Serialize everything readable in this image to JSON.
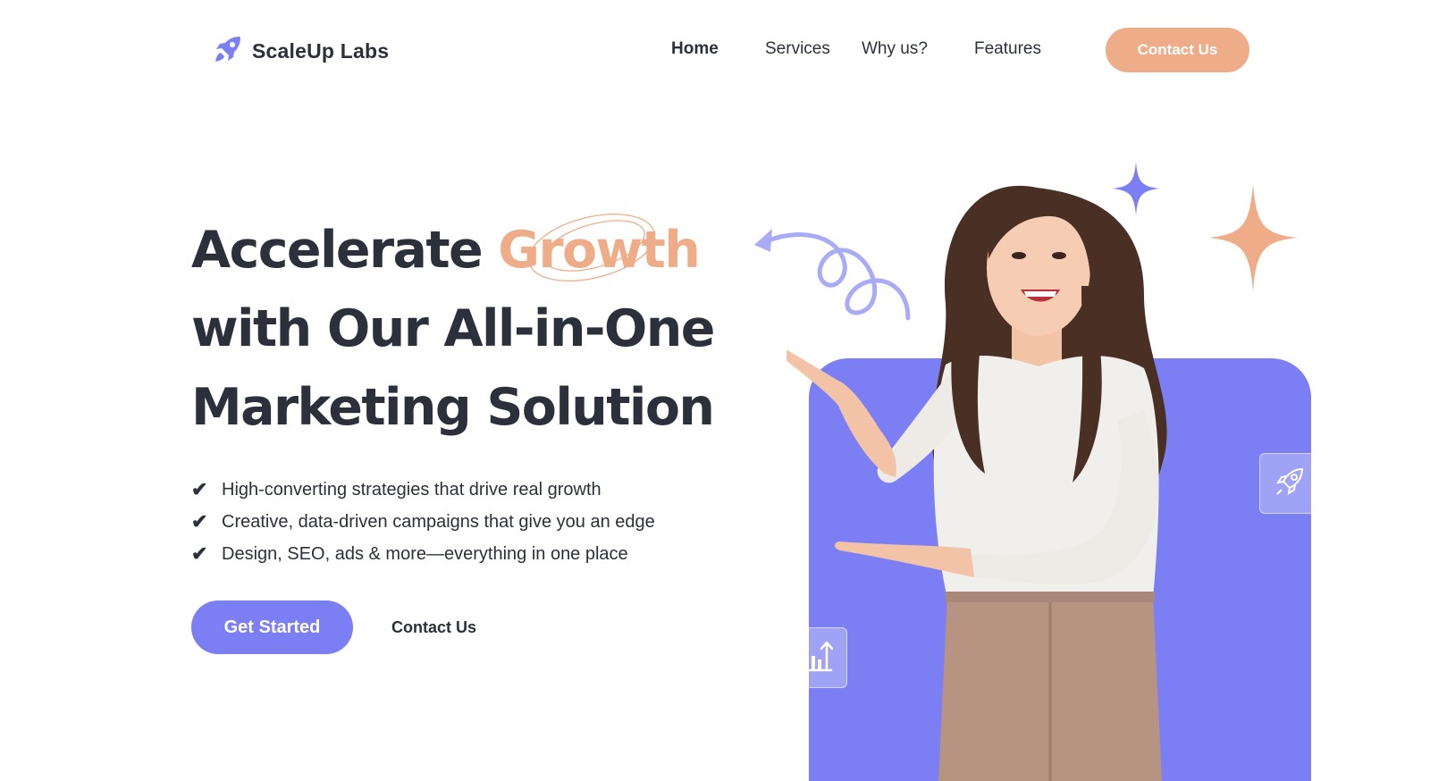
{
  "brand": {
    "name": "ScaleUp Labs",
    "logo_icon": "rocket-icon",
    "primary_color": "#7c7ff3",
    "accent_color": "#efac88",
    "text_color": "#2b303b"
  },
  "nav": {
    "items": [
      {
        "label": "Home",
        "active": true
      },
      {
        "label": "Services",
        "active": false
      },
      {
        "label": "Why us?",
        "active": false
      },
      {
        "label": "Features",
        "active": false
      }
    ],
    "cta_label": "Contact Us"
  },
  "hero": {
    "headline_line1_prefix": "Accelerate",
    "headline_highlight": "Growth",
    "headline_line2": "with Our All-in-One",
    "headline_line3": "Marketing Solution",
    "features": [
      "High-converting strategies that drive real growth",
      "Creative, data-driven campaigns that give you an edge",
      "Design, SEO, ads & more—everything in one place"
    ],
    "primary_button": "Get Started",
    "secondary_link": "Contact Us"
  },
  "visual": {
    "icons": [
      "sparkle-star-icon",
      "curly-arrow-icon",
      "rocket-icon",
      "bar-chart-icon"
    ]
  }
}
